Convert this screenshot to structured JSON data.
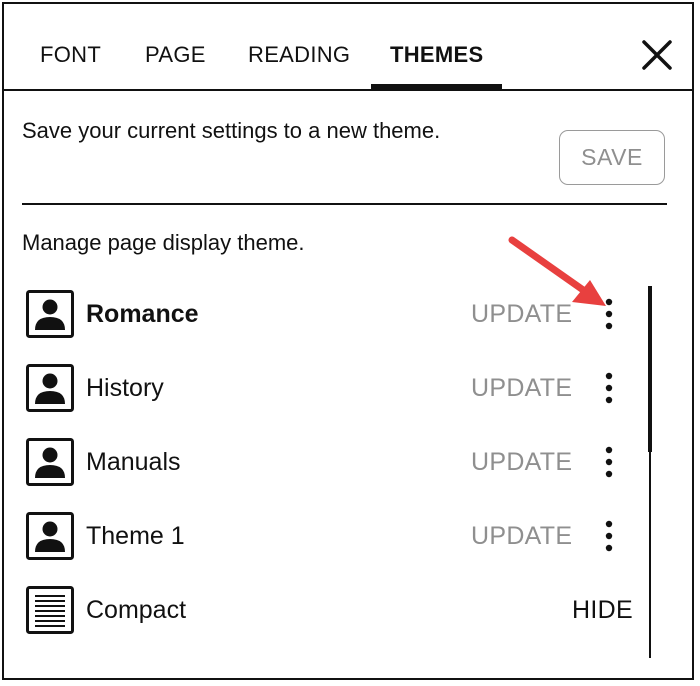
{
  "tabs": [
    {
      "label": "FONT",
      "active": false
    },
    {
      "label": "PAGE",
      "active": false
    },
    {
      "label": "READING",
      "active": false
    },
    {
      "label": "THEMES",
      "active": true
    }
  ],
  "close": {
    "icon": "close-icon"
  },
  "save_section": {
    "text": "Save your current settings to a new theme.",
    "button_label": "SAVE",
    "button_enabled": false
  },
  "manage_section": {
    "text": "Manage page display theme."
  },
  "themes": [
    {
      "label": "Romance",
      "bold": true,
      "action": "UPDATE",
      "icon": "person-icon",
      "has_more": true
    },
    {
      "label": "History",
      "bold": false,
      "action": "UPDATE",
      "icon": "person-icon",
      "has_more": true
    },
    {
      "label": "Manuals",
      "bold": false,
      "action": "UPDATE",
      "icon": "person-icon",
      "has_more": true
    },
    {
      "label": "Theme 1",
      "bold": false,
      "action": "UPDATE",
      "icon": "person-icon",
      "has_more": true
    },
    {
      "label": "Compact",
      "bold": false,
      "action": "HIDE",
      "icon": "text-lines-icon",
      "has_more": false
    }
  ],
  "colors": {
    "text": "#111111",
    "disabled": "#8f8f8f",
    "annotation_arrow": "#e8403f"
  }
}
